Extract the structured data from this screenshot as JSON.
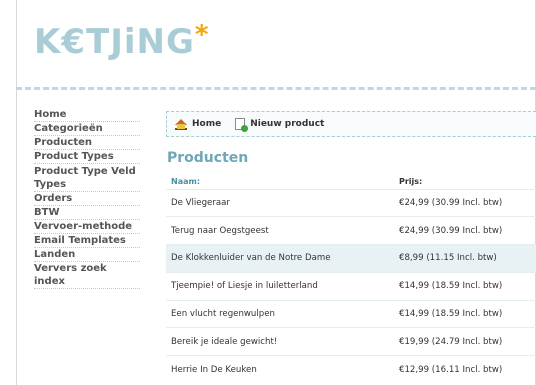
{
  "logo": {
    "text": "K€TJiNG",
    "star": "*"
  },
  "sidebar": {
    "items": [
      {
        "label": "Home"
      },
      {
        "label": "Categorieën"
      },
      {
        "label": "Producten"
      },
      {
        "label": "Product Types"
      },
      {
        "label": "Product Type Veld Types"
      },
      {
        "label": "Orders"
      },
      {
        "label": "BTW"
      },
      {
        "label": "Vervoer-methode"
      },
      {
        "label": "Email Templates"
      },
      {
        "label": "Landen"
      },
      {
        "label": "Ververs zoek index"
      }
    ]
  },
  "breadcrumb": {
    "home": "Home",
    "new_product": "Nieuw product"
  },
  "main": {
    "title": "Producten"
  },
  "table": {
    "headers": {
      "name": "Naam:",
      "price": "Prijs:"
    },
    "rows": [
      {
        "name": "De Vliegeraar",
        "price": "€24,99 (30.99 Incl. btw)"
      },
      {
        "name": "Terug naar Oegstgeest",
        "price": "€24,99 (30.99 Incl. btw)"
      },
      {
        "name": "De Klokkenluider van de Notre Dame",
        "price": "€8,99 (11.15 Incl. btw)"
      },
      {
        "name": "Tjeempie! of Liesje in luiletterland",
        "price": "€14,99 (18.59 Incl. btw)"
      },
      {
        "name": "Een vlucht regenwulpen",
        "price": "€14,99 (18.59 Incl. btw)"
      },
      {
        "name": "Bereik je ideale gewicht!",
        "price": "€19,99 (24.79 Incl. btw)"
      },
      {
        "name": "Herrie In De Keuken",
        "price": "€12,99 (16.11 Incl. btw)"
      }
    ]
  }
}
